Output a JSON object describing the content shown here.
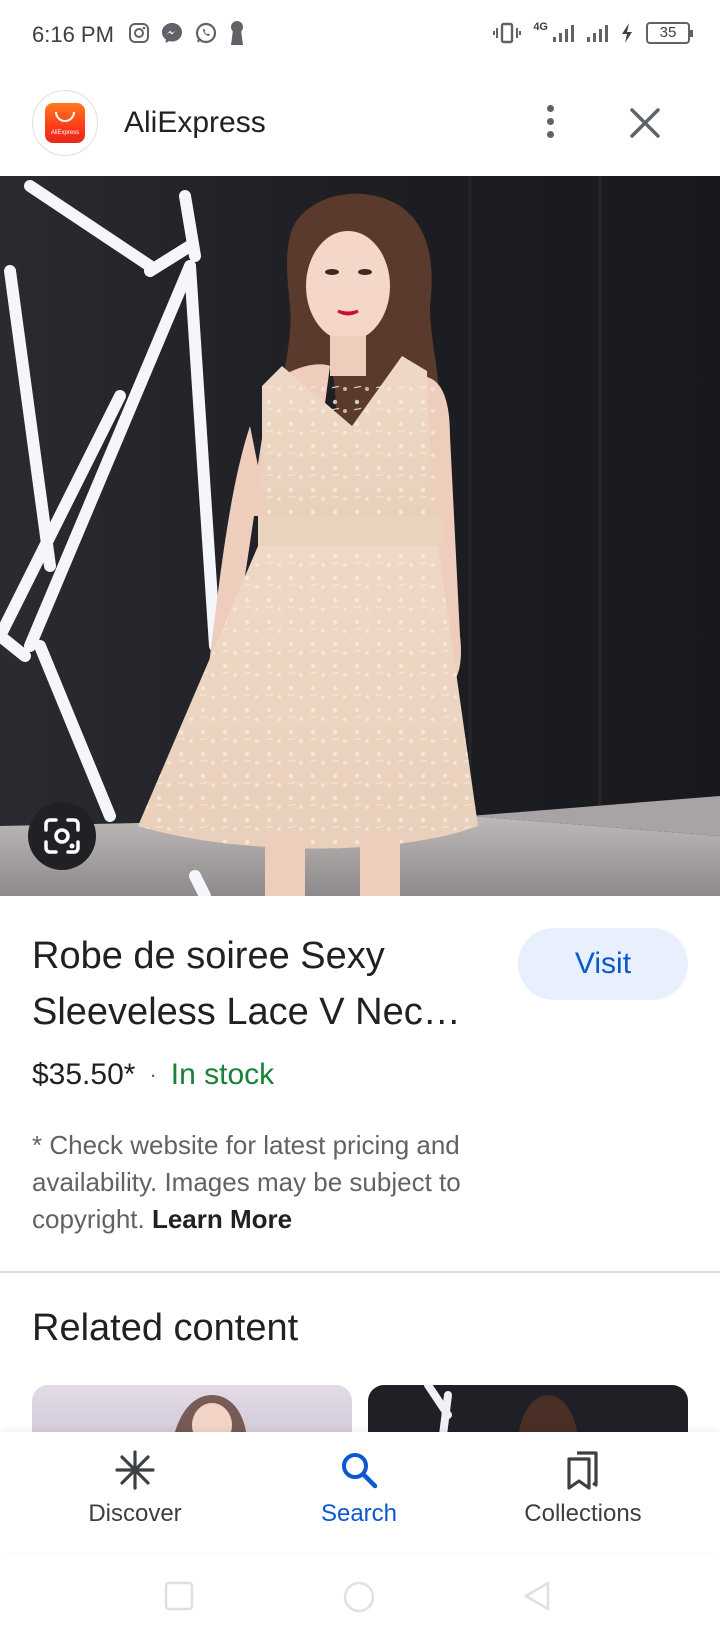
{
  "status_bar": {
    "time": "6:16 PM",
    "network": "4G",
    "battery": "35"
  },
  "header": {
    "app_name": "AliExpress",
    "logo_text": "AliExpress"
  },
  "product": {
    "title_line1": "Robe de soiree Sexy",
    "title_line2": "Sleeveless Lace V Nec…",
    "price": "$35.50*",
    "separator": "·",
    "stock": "In stock",
    "disclaimer": "* Check website for latest pricing and availability. Images may be subject to copyright.",
    "learn_more": "Learn More",
    "visit_label": "Visit"
  },
  "related": {
    "title": "Related content"
  },
  "bottom_nav": {
    "items": [
      {
        "label": "Discover",
        "icon": "asterisk-icon",
        "active": false
      },
      {
        "label": "Search",
        "icon": "search-icon",
        "active": true
      },
      {
        "label": "Collections",
        "icon": "bookmarks-icon",
        "active": false
      }
    ]
  },
  "colors": {
    "accent": "#0b57d0",
    "visit_bg": "#e8f0fe",
    "in_stock": "#188038",
    "logo_orange": "#ff4a1a"
  }
}
